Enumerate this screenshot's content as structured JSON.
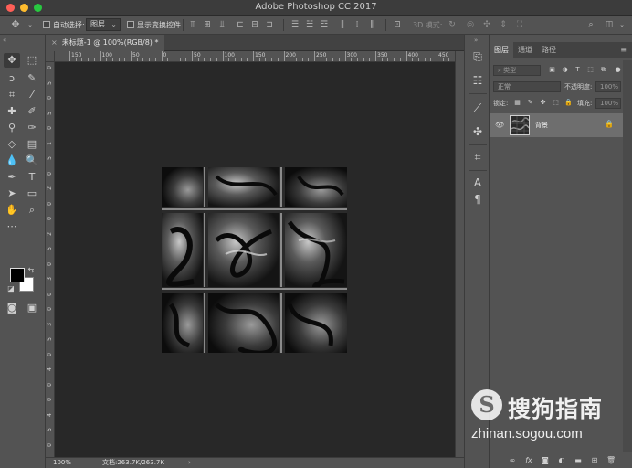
{
  "window": {
    "title": "Adobe Photoshop CC 2017",
    "traffic_lights": [
      "#ff5f57",
      "#febc2e",
      "#28c840"
    ]
  },
  "options_bar": {
    "auto_select_label": "自动选择:",
    "auto_select_target": "图层",
    "show_transform_label": "显示变换控件",
    "mode_3d_label": "3D 模式:"
  },
  "document": {
    "tab_title": "未标题-1 @ 100%(RGB/8) *",
    "close_glyph": "×"
  },
  "ruler": {
    "top_labels": [
      "150",
      "100",
      "50",
      "0",
      "50",
      "100",
      "150",
      "200",
      "250",
      "300",
      "350",
      "400",
      "450"
    ],
    "left_labels": [
      "0",
      "5",
      "0",
      "5",
      "0",
      "1",
      "5",
      "0",
      "2",
      "0",
      "0",
      "2",
      "5",
      "0",
      "3",
      "0",
      "0",
      "3",
      "5",
      "0",
      "4",
      "0",
      "0",
      "4",
      "5",
      "0"
    ]
  },
  "status": {
    "zoom": "100%",
    "doc_info": "文档:263.7K/263.7K",
    "arrow": "›"
  },
  "panels": {
    "tabs": [
      "图层",
      "通道",
      "路径"
    ],
    "active_tab": "图层",
    "filter_label": "类型",
    "blend_mode": "正常",
    "opacity_label": "不透明度:",
    "opacity_value": "100%",
    "lock_label": "锁定:",
    "fill_label": "填充:",
    "fill_value": "100%",
    "layers": [
      {
        "name": "背景",
        "visible": true,
        "locked": true
      }
    ]
  },
  "watermark": {
    "logo_letter": "S",
    "brand": "搜狗指南",
    "url": "zhinan.sogou.com"
  },
  "colors": {
    "accent_fg": "#000000",
    "accent_bg": "#ffffff"
  }
}
